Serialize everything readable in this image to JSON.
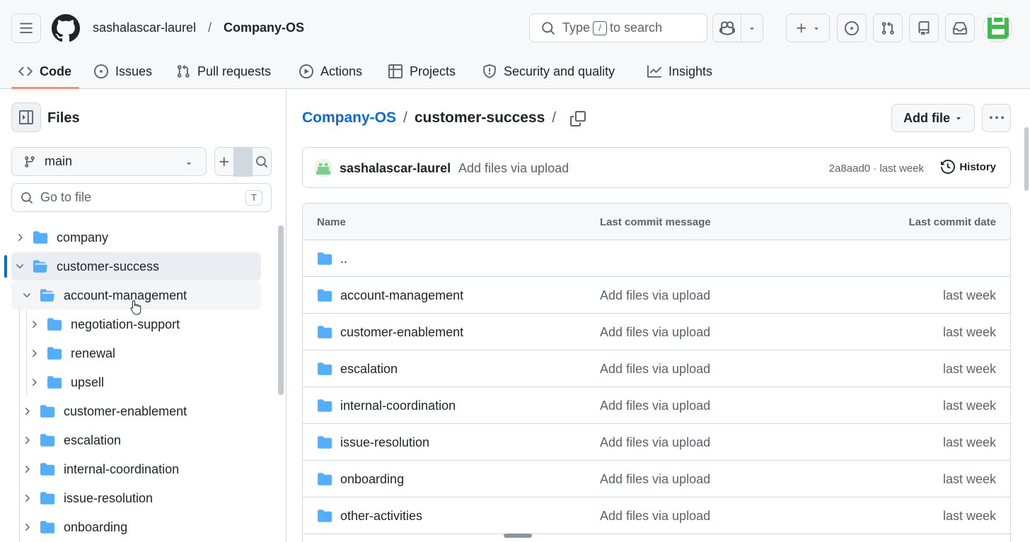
{
  "header": {
    "owner": "sashalascar-laurel",
    "separator": "/",
    "repo": "Company-OS",
    "search": {
      "prefix": "Type",
      "key": "/",
      "suffix": "to search"
    },
    "icons": [
      "menu-icon",
      "github-logo-icon",
      "search-icon",
      "copilot-icon",
      "plus-icon",
      "issue-opened-icon",
      "pull-request-icon",
      "repo-icon",
      "inbox-icon",
      "avatar"
    ]
  },
  "tabs": [
    {
      "label": "Code",
      "icon": "code-icon",
      "active": true
    },
    {
      "label": "Issues",
      "icon": "issue-icon"
    },
    {
      "label": "Pull requests",
      "icon": "pull-request-icon"
    },
    {
      "label": "Actions",
      "icon": "play-icon"
    },
    {
      "label": "Projects",
      "icon": "table-icon"
    },
    {
      "label": "Security and quality",
      "icon": "shield-icon"
    },
    {
      "label": "Insights",
      "icon": "graph-icon"
    }
  ],
  "sidebar": {
    "title": "Files",
    "branch": "main",
    "goto_placeholder": "Go to file",
    "goto_key": "T",
    "tree": [
      {
        "label": "company",
        "level": 0,
        "expanded": false
      },
      {
        "label": "customer-success",
        "level": 0,
        "expanded": true,
        "selected": true
      },
      {
        "label": "account-management",
        "level": 1,
        "expanded": true,
        "hovered": true
      },
      {
        "label": "negotiation-support",
        "level": 2,
        "expanded": false
      },
      {
        "label": "renewal",
        "level": 2,
        "expanded": false
      },
      {
        "label": "upsell",
        "level": 2,
        "expanded": false
      },
      {
        "label": "customer-enablement",
        "level": 1,
        "expanded": false
      },
      {
        "label": "escalation",
        "level": 1,
        "expanded": false
      },
      {
        "label": "internal-coordination",
        "level": 1,
        "expanded": false
      },
      {
        "label": "issue-resolution",
        "level": 1,
        "expanded": false
      },
      {
        "label": "onboarding",
        "level": 1,
        "expanded": false
      }
    ]
  },
  "main": {
    "breadcrumb": {
      "root": "Company-OS",
      "sep": "/",
      "current": "customer-success",
      "trailing": "/"
    },
    "add_file": "Add file",
    "commit": {
      "user": "sashalascar-laurel",
      "message": "Add files via upload",
      "meta": "2a8aad0 · last week",
      "history": "History"
    },
    "table": {
      "headers": {
        "name": "Name",
        "message": "Last commit message",
        "date": "Last commit date"
      },
      "parent": "..",
      "rows": [
        {
          "name": "account-management",
          "message": "Add files via upload",
          "date": "last week"
        },
        {
          "name": "customer-enablement",
          "message": "Add files via upload",
          "date": "last week"
        },
        {
          "name": "escalation",
          "message": "Add files via upload",
          "date": "last week"
        },
        {
          "name": "internal-coordination",
          "message": "Add files via upload",
          "date": "last week"
        },
        {
          "name": "issue-resolution",
          "message": "Add files via upload",
          "date": "last week"
        },
        {
          "name": "onboarding",
          "message": "Add files via upload",
          "date": "last week"
        },
        {
          "name": "other-activities",
          "message": "Add files via upload",
          "date": "last week"
        }
      ]
    }
  },
  "colors": {
    "link": "#0969da",
    "folder": "#54aeff",
    "tab_underline": "#fd8c73",
    "selected_marker": "#0969da"
  }
}
